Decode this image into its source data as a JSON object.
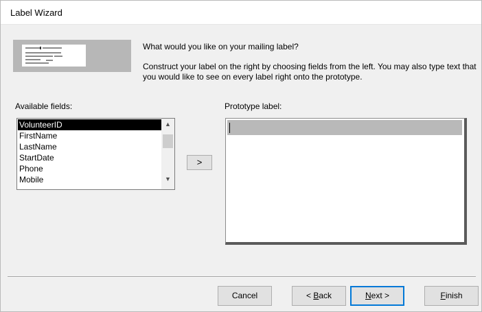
{
  "window": {
    "title": "Label Wizard"
  },
  "header": {
    "question": "What would you like on your mailing label?",
    "description": "Construct your label on the right by choosing fields from the left. You may also type text that you would like to see on every label right onto the prototype."
  },
  "available_fields": {
    "label": "Available fields:",
    "items": [
      "VolunteerID",
      "FirstName",
      "LastName",
      "StartDate",
      "Phone",
      "Mobile"
    ],
    "selected": "VolunteerID"
  },
  "move_button": {
    "label": ">"
  },
  "prototype": {
    "label": "Prototype label:"
  },
  "buttons": {
    "cancel": "Cancel",
    "back_prefix": "< ",
    "back_key": "B",
    "back_rest": "ack",
    "next_key": "N",
    "next_rest": "ext >",
    "finish_key": "F",
    "finish_rest": "inish"
  },
  "colors": {
    "accent": "#0078d7",
    "selection": "#000000",
    "dialog_bg": "#f0f0f0"
  }
}
